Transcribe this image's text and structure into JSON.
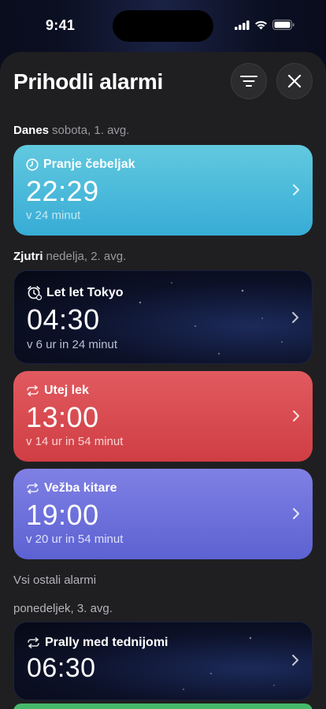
{
  "status": {
    "time": "9:41"
  },
  "sheet": {
    "title": "Prihodli alarmi"
  },
  "sections": {
    "today": {
      "label": "Danes",
      "date": "sobota, 1. avg."
    },
    "tomorrow": {
      "label": "Zjutri",
      "date": "nedelja, 2. avg."
    },
    "others": {
      "label": "Vsi ostali alarmi"
    },
    "monday": {
      "date": "ponedeljek, 3. avg."
    }
  },
  "alarms": [
    {
      "name": "Pranje čebeljak",
      "time": "22:29",
      "remaining": "v 24 minut",
      "icon": "clock-icon",
      "color": "#3fb3d8"
    },
    {
      "name": "Let let Tokyo",
      "time": "04:30",
      "remaining": "v 6 ur in 24 minut",
      "icon": "alarm-clock-icon",
      "color": "#0c1128"
    },
    {
      "name": "Utej lek",
      "time": "13:00",
      "remaining": "v 14 ur in 54 minut",
      "icon": "repeat-icon",
      "color": "#d9484e"
    },
    {
      "name": "Vežba kitare",
      "time": "19:00",
      "remaining": "v 20 ur in 54 minut",
      "icon": "repeat-icon",
      "color": "#6b70da"
    },
    {
      "name": "Prally med tednijomi",
      "time": "06:30",
      "icon": "repeat-icon",
      "color": "#0c1128"
    }
  ]
}
